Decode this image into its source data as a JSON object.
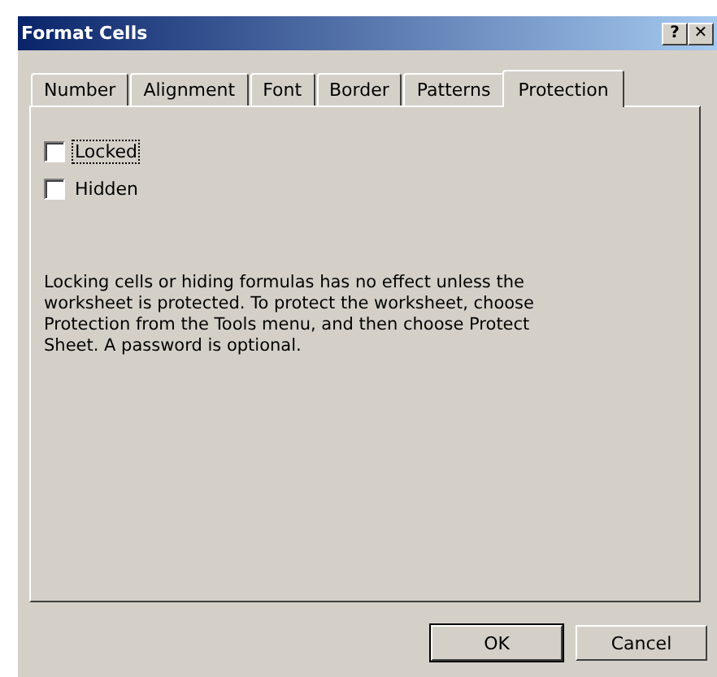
{
  "window": {
    "title": "Format Cells",
    "help_button": "?",
    "close_button": "✕"
  },
  "tabs": [
    {
      "label": "Number",
      "selected": false
    },
    {
      "label": "Alignment",
      "selected": false
    },
    {
      "label": "Font",
      "selected": false
    },
    {
      "label": "Border",
      "selected": false
    },
    {
      "label": "Patterns",
      "selected": false
    },
    {
      "label": "Protection",
      "selected": true
    }
  ],
  "options": [
    {
      "label": "Locked",
      "checked": false,
      "focused": true
    },
    {
      "label": "Hidden",
      "checked": false,
      "focused": false
    }
  ],
  "note": "Locking cells or hiding formulas has no effect unless the worksheet is protected. To protect the worksheet, choose Protection from the Tools menu, and then choose Protect Sheet. A password is optional.",
  "buttons": [
    {
      "label": "OK",
      "default": true
    },
    {
      "label": "Cancel",
      "default": false
    }
  ]
}
